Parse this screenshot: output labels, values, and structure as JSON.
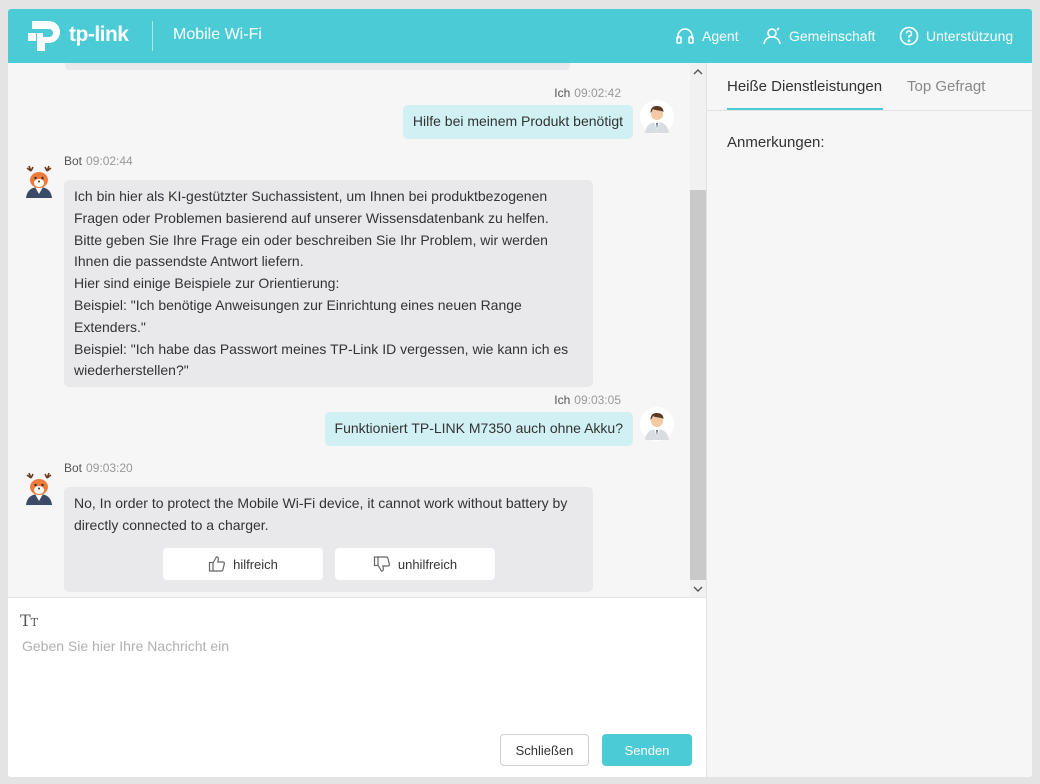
{
  "header": {
    "brand": "tp-link",
    "product": "Mobile Wi-Fi",
    "nav": {
      "agent": "Agent",
      "community": "Gemeinschaft",
      "support": "Unterstützung"
    }
  },
  "chat": {
    "messages": [
      {
        "sender": "Ich",
        "time": "09:02:42",
        "text": "Hilfe bei meinem Produkt benötigt"
      },
      {
        "sender": "Bot",
        "time": "09:02:44",
        "lines": [
          "Ich bin hier als KI-gestützter Suchassistent, um Ihnen bei produktbezogenen",
          "Fragen oder Problemen basierend auf unserer Wissensdatenbank zu helfen.",
          "Bitte geben Sie Ihre Frage ein oder beschreiben Sie Ihr Problem, wir werden",
          "Ihnen die passendste Antwort liefern.",
          "Hier sind einige Beispiele zur Orientierung:",
          "Beispiel: \"Ich benötige Anweisungen zur Einrichtung eines neuen Range",
          "Extenders.\"",
          "Beispiel: \"Ich habe das Passwort meines TP-Link ID vergessen, wie kann ich es",
          "wiederherstellen?\""
        ]
      },
      {
        "sender": "Ich",
        "time": "09:03:05",
        "text": "Funktioniert TP-LINK M7350 auch ohne Akku?"
      },
      {
        "sender": "Bot",
        "time": "09:03:20",
        "lines": [
          "No, In order to protect the Mobile Wi-Fi device, it cannot work without battery by",
          "directly connected to a charger."
        ]
      }
    ],
    "feedback": {
      "helpful": "hilfreich",
      "unhelpful": "unhilfreich"
    }
  },
  "input": {
    "placeholder": "Geben Sie hier Ihre Nachricht ein",
    "value": "",
    "close_label": "Schließen",
    "send_label": "Senden"
  },
  "sidebar": {
    "tabs": [
      "Heiße Dienstleistungen",
      "Top Gefragt"
    ],
    "active_tab": "Heiße Dienstleistungen",
    "notes_label": "Anmerkungen:"
  },
  "colors": {
    "accent": "#4acbd6",
    "user_bubble": "#d1f0f3",
    "bot_bubble": "#e9e9ec"
  },
  "icons": [
    "tp-link-logo-icon",
    "headset-icon",
    "community-icon",
    "help-circle-icon",
    "user-avatar-icon",
    "bot-avatar-icon",
    "thumbs-up-icon",
    "thumbs-down-icon",
    "text-format-icon",
    "scroll-up-icon",
    "scroll-down-icon"
  ]
}
